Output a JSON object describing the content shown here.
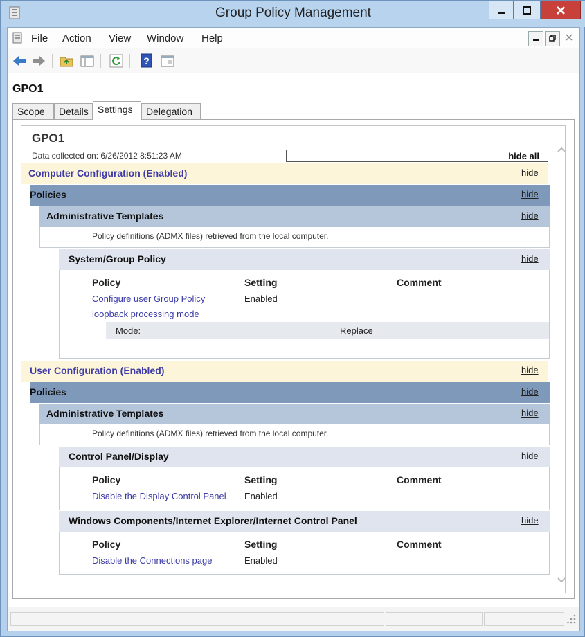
{
  "window": {
    "title": "Group Policy Management"
  },
  "menu": {
    "items": [
      "File",
      "Action",
      "View",
      "Window",
      "Help"
    ]
  },
  "gpo_name": "GPO1",
  "tabs": [
    {
      "label": "Scope"
    },
    {
      "label": "Details"
    },
    {
      "label": "Settings"
    },
    {
      "label": "Delegation"
    }
  ],
  "report": {
    "title": "GPO1",
    "collected": "Data collected on: 6/26/2012 8:51:23 AM",
    "hide_all": "hide all",
    "hide": "hide",
    "computer": {
      "heading": "Computer Configuration (Enabled)",
      "policies": "Policies",
      "admin": "Administrative Templates",
      "note": "Policy definitions (ADMX files) retrieved from the local computer.",
      "section": "System/Group Policy",
      "headers": {
        "policy": "Policy",
        "setting": "Setting",
        "comment": "Comment"
      },
      "row": {
        "policy_line1": "Configure user Group Policy",
        "policy_line2": "loopback processing mode",
        "setting": "Enabled"
      },
      "mode": {
        "label": "Mode:",
        "value": "Replace"
      }
    },
    "user": {
      "heading": "User Configuration (Enabled)",
      "policies": "Policies",
      "admin": "Administrative Templates",
      "note": "Policy definitions (ADMX files) retrieved from the local computer.",
      "section1": "Control Panel/Display",
      "headers1": {
        "policy": "Policy",
        "setting": "Setting",
        "comment": "Comment"
      },
      "row1": {
        "policy": "Disable the Display Control Panel",
        "setting": "Enabled"
      },
      "section2": "Windows Components/Internet Explorer/Internet Control Panel",
      "headers2": {
        "policy": "Policy",
        "setting": "Setting",
        "comment": "Comment"
      },
      "row2": {
        "policy": "Disable the Connections page",
        "setting": "Enabled"
      }
    }
  }
}
